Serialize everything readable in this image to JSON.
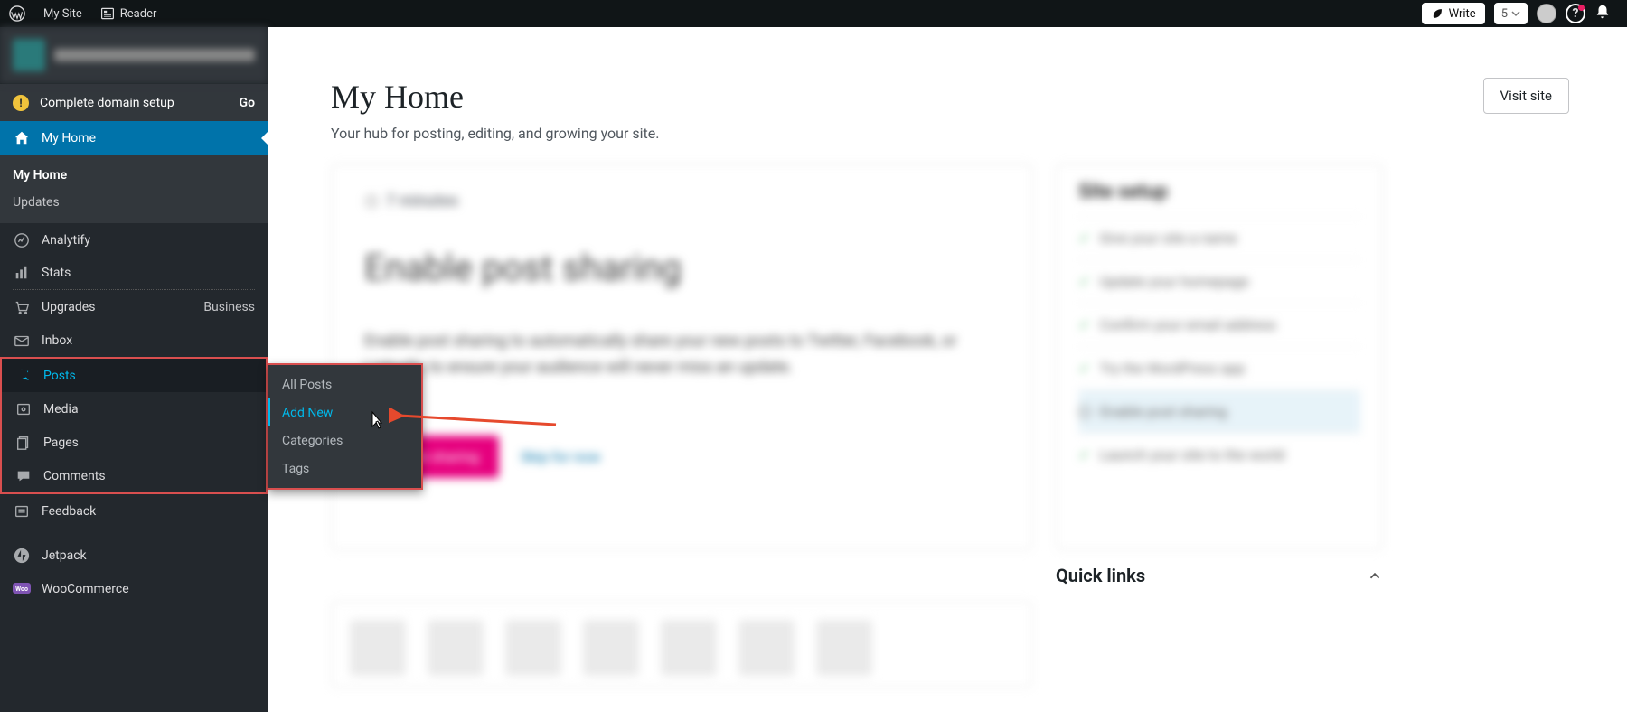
{
  "topbar": {
    "my_site": "My Site",
    "reader": "Reader",
    "write": "Write",
    "count": "5"
  },
  "sidebar": {
    "domain_setup": "Complete domain setup",
    "go": "Go",
    "my_home": "My Home",
    "sub_my_home": "My Home",
    "sub_updates": "Updates",
    "analytify": "Analytify",
    "stats": "Stats",
    "upgrades": "Upgrades",
    "upgrades_r": "Business",
    "inbox": "Inbox",
    "posts": "Posts",
    "media": "Media",
    "pages": "Pages",
    "comments": "Comments",
    "feedback": "Feedback",
    "jetpack": "Jetpack",
    "woocommerce": "WooCommerce"
  },
  "flyout": {
    "all_posts": "All Posts",
    "add_new": "Add New",
    "categories": "Categories",
    "tags": "Tags"
  },
  "main": {
    "title": "My Home",
    "subtitle": "Your hub for posting, editing, and growing your site.",
    "visit": "Visit site",
    "card_tag": "7 minutes",
    "card_h": "Enable post sharing",
    "card_p": "Enable post sharing to automatically share your new posts to Twitter, Facebook, or LinkedIn to ensure your audience will never miss an update.",
    "card_btn": "Enable sharing",
    "card_skip": "Skip for now",
    "setup_title": "Site setup",
    "setup_items": [
      "Give your site a name",
      "Update your homepage",
      "Confirm your email address",
      "Try the WordPress app",
      "Enable post sharing",
      "Launch your site to the world"
    ],
    "quick_links": "Quick links"
  }
}
